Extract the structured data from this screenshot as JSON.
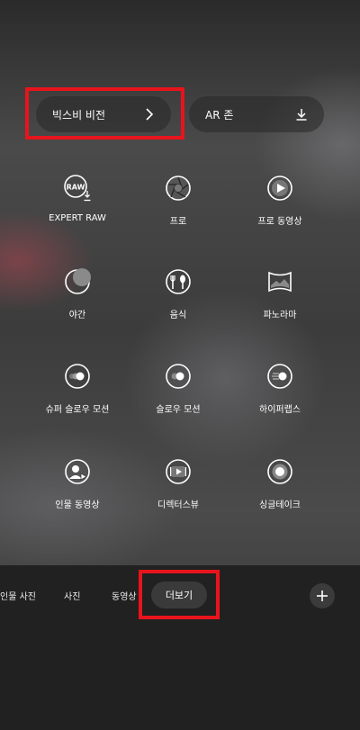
{
  "top": {
    "bixby_label": "빅스비 비전",
    "ar_label": "AR 존"
  },
  "modes": [
    {
      "label": "EXPERT RAW",
      "icon": "raw-download-icon"
    },
    {
      "label": "프로",
      "icon": "aperture-icon"
    },
    {
      "label": "프로 동영상",
      "icon": "play-circle-icon"
    },
    {
      "label": "야간",
      "icon": "moon-icon"
    },
    {
      "label": "음식",
      "icon": "fork-knife-icon"
    },
    {
      "label": "파노라마",
      "icon": "panorama-icon"
    },
    {
      "label": "슈퍼 슬로우 모션",
      "icon": "super-slow-motion-icon"
    },
    {
      "label": "슬로우 모션",
      "icon": "slow-motion-icon"
    },
    {
      "label": "하이퍼랩스",
      "icon": "hyperlapse-icon"
    },
    {
      "label": "인물 동영상",
      "icon": "portrait-video-icon"
    },
    {
      "label": "디렉터스뷰",
      "icon": "directors-view-icon"
    },
    {
      "label": "싱글테이크",
      "icon": "single-take-icon"
    }
  ],
  "tabs": {
    "people": "인물 사진",
    "photo": "사진",
    "video": "동영상",
    "more": "더보기"
  },
  "colors": {
    "highlight": "#e8141c"
  }
}
